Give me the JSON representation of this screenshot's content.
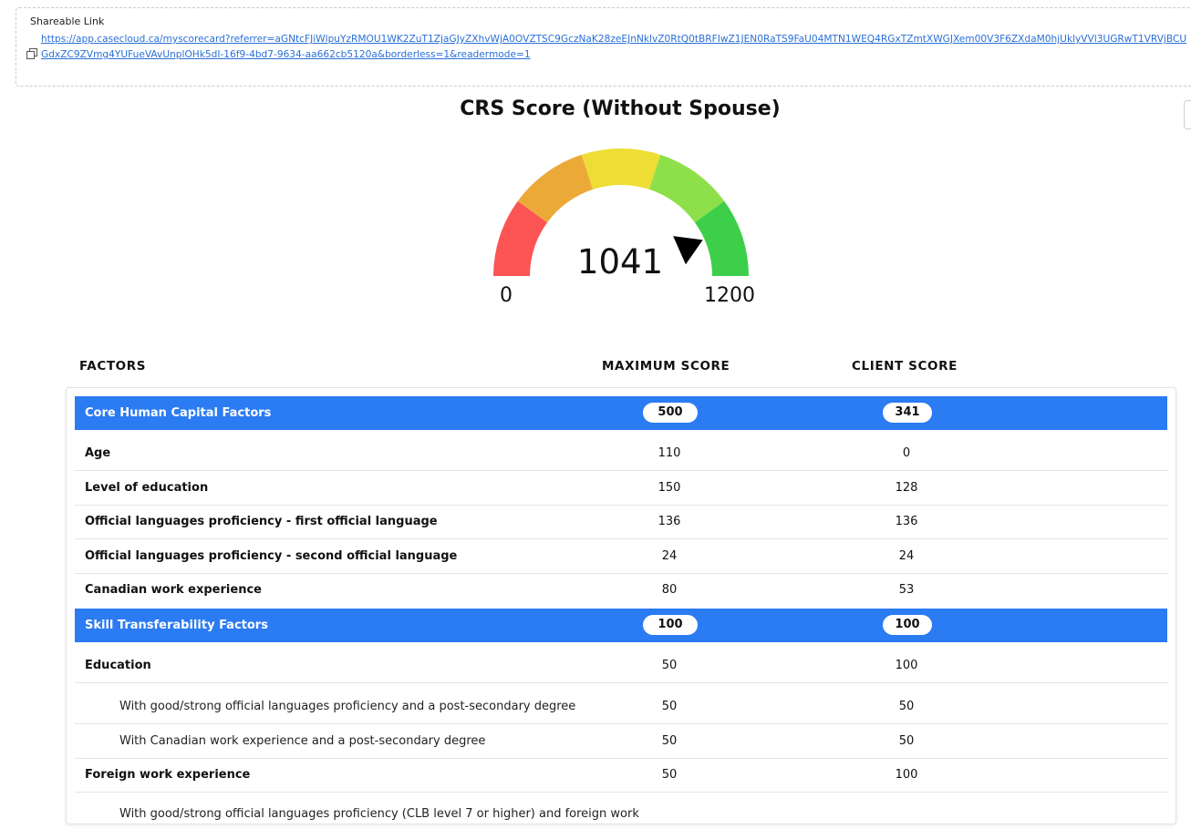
{
  "share": {
    "label": "Shareable Link",
    "url": "https://app.casecloud.ca/myscorecard?referrer=aGNtcFJiWlpuYzRMOU1WK2ZuT1ZjaGJyZXhvWjA0OVZTSC9GczNaK28zeEJnNklvZ0RtQ0tBRFIwZ1JEN0RaTS9FaU04MTN1WEQ4RGxTZmtXWGJXem00V3F6ZXdaM0hjUklyVVl3UGRwT1VRVjBCUGdxZC9ZVmg4YUFueVAvUnplOHk5dI-16f9-4bd7-9634-aa662cb5120a&borderless=1&readermode=1"
  },
  "gauge": {
    "title": "CRS Score (Without Spouse)",
    "value": "1041",
    "min_label": "0",
    "max_label": "1200",
    "value_number": 1041,
    "max_number": 1200,
    "colors": [
      "#fc5454",
      "#ebaa38",
      "#eedd35",
      "#8ee04a",
      "#3ecf4a"
    ]
  },
  "table": {
    "headers": {
      "factors": "FACTORS",
      "max": "MAXIMUM SCORE",
      "client": "CLIENT SCORE"
    },
    "groups": [
      {
        "label": "Core Human Capital Factors",
        "max": "500",
        "client": "341"
      },
      {
        "label": "Skill Transferability Factors",
        "max": "100",
        "client": "100"
      }
    ],
    "rows": [
      {
        "label": "Age",
        "max": "110",
        "client": "0"
      },
      {
        "label": "Level of education",
        "max": "150",
        "client": "128"
      },
      {
        "label": "Official languages proficiency - first official language",
        "max": "136",
        "client": "136"
      },
      {
        "label": "Official languages proficiency - second official language",
        "max": "24",
        "client": "24"
      },
      {
        "label": "Canadian work experience",
        "max": "80",
        "client": "53"
      },
      {
        "label": "Education",
        "max": "50",
        "client": "100"
      },
      {
        "label": "With good/strong official languages proficiency and a post-secondary degree",
        "max": "50",
        "client": "50"
      },
      {
        "label": "With Canadian work experience and a post-secondary degree",
        "max": "50",
        "client": "50"
      },
      {
        "label": "Foreign work experience",
        "max": "50",
        "client": "100"
      },
      {
        "label": "With good/strong official languages proficiency (CLB level 7 or higher) and foreign work",
        "max": "",
        "client": ""
      }
    ]
  }
}
